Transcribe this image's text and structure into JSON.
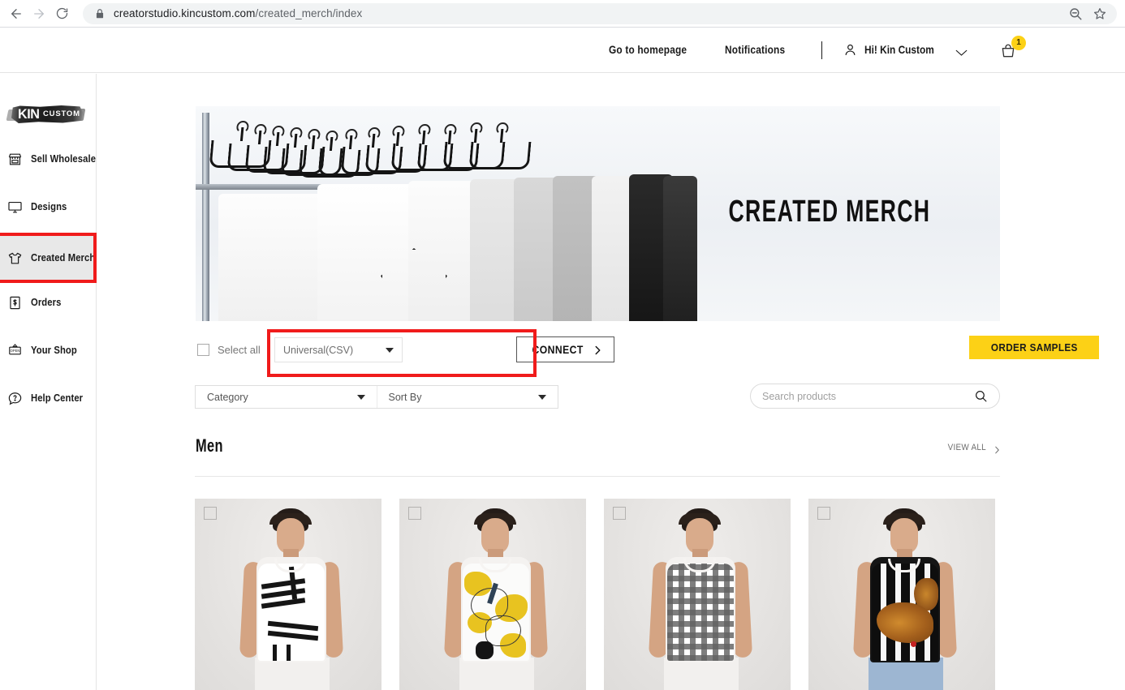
{
  "browser": {
    "url_host": "creatorstudio.kincustom.com",
    "url_path": "/created_merch/index",
    "back_icon": "arrow-left-icon",
    "forward_icon": "arrow-right-icon",
    "reload_icon": "reload-icon",
    "lock_icon": "lock-icon",
    "zoom_icon": "zoom-out-icon",
    "bookmark_icon": "star-icon"
  },
  "topbar": {
    "homepage_link": "Go to homepage",
    "notifications_link": "Notifications",
    "account_greeting": "Hi! Kin Custom",
    "cart_count": "1",
    "cart_badge_color": "#fcd116"
  },
  "sidebar": {
    "logo_primary": "KIN",
    "logo_secondary": "CUSTOM",
    "active_index": 2,
    "active_highlight_color": "#f01b1b",
    "items": [
      {
        "label": "Sell Wholesale",
        "icon": "storefront-icon"
      },
      {
        "label": "Designs",
        "icon": "monitor-icon"
      },
      {
        "label": "Created Merch",
        "icon": "tshirt-icon"
      },
      {
        "label": "Orders",
        "icon": "receipt-dollar-icon"
      },
      {
        "label": "Your Shop",
        "icon": "open-sign-icon"
      },
      {
        "label": "Help Center",
        "icon": "question-circle-icon"
      }
    ]
  },
  "hero": {
    "title": "CREATED MERCH"
  },
  "controls": {
    "select_all_label": "Select all",
    "export_format": "Universal(CSV)",
    "connect_label": "CONNECT",
    "order_samples_label": "ORDER SAMPLES",
    "category_label": "Category",
    "sort_by_label": "Sort By",
    "search_placeholder": "Search products",
    "highlight_color": "#f01b1b",
    "order_samples_color": "#fcd116"
  },
  "section": {
    "title": "Men",
    "view_all_label": "VIEW ALL"
  },
  "products": [
    {
      "alt": "Men's tank top with black geometric stripe print",
      "selected": false
    },
    {
      "alt": "Men's tank top with yellow and white floral leaf print",
      "selected": false
    },
    {
      "alt": "Men's tank top with black and white gingham check print",
      "selected": false
    },
    {
      "alt": "Men's tee with black and white vertical stripes and tiger graphic",
      "selected": false
    }
  ]
}
